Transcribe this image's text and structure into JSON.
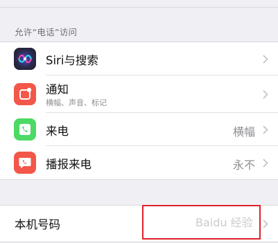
{
  "section_header": "允许“电话”访问",
  "items": [
    {
      "label": "Siri与搜索",
      "icon": "siri-icon"
    },
    {
      "label": "通知",
      "sublabel": "横幅、声音、标记",
      "icon": "notifications-icon"
    },
    {
      "label": "来电",
      "value": "横幅",
      "icon": "phone-call-icon"
    },
    {
      "label": "播报来电",
      "value": "永不",
      "icon": "announce-call-icon"
    }
  ],
  "my_number": {
    "label": "本机号码"
  },
  "watermark": "Baidu 经验",
  "colors": {
    "siri": "#2b2b40",
    "notifications": "#f2574a",
    "phone_green": "#4cd964",
    "announce_red": "#f2574a",
    "highlight": "#e0202a"
  }
}
